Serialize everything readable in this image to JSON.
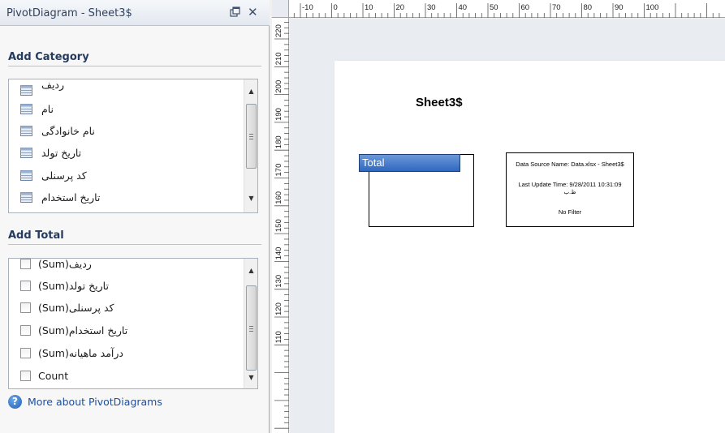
{
  "pane": {
    "title": "PivotDiagram - Sheet3$",
    "add_category": {
      "header": "Add Category",
      "items": [
        {
          "label": "ردیف",
          "icon": "category-table-icon"
        },
        {
          "label": "نام",
          "icon": "category-table-icon"
        },
        {
          "label": "نام خانوادگی",
          "icon": "category-table-icon"
        },
        {
          "label": "تاریخ تولد",
          "icon": "category-table-icon"
        },
        {
          "label": "کد پرسنلی",
          "icon": "category-table-icon"
        },
        {
          "label": "تاریخ استخدام",
          "icon": "category-table-icon"
        }
      ]
    },
    "add_total": {
      "header": "Add Total",
      "items": [
        {
          "label": "ردیف(Sum)",
          "checked": false
        },
        {
          "label": "تاریخ تولد(Sum)",
          "checked": false
        },
        {
          "label": "کد پرسنلی(Sum)",
          "checked": false
        },
        {
          "label": "تاریخ استخدام(Sum)",
          "checked": false
        },
        {
          "label": "درآمد ماهیانه(Sum)",
          "checked": false
        },
        {
          "label": "Count",
          "checked": false
        }
      ]
    },
    "help_link": "More about PivotDiagrams"
  },
  "rulers": {
    "horizontal_labels": [
      "-10",
      "0",
      "10",
      "20",
      "30",
      "40",
      "50",
      "60",
      "70",
      "80",
      "90",
      "100"
    ],
    "vertical_labels": [
      "220",
      "210",
      "200",
      "190",
      "180",
      "170",
      "160",
      "150",
      "140",
      "130",
      "120",
      "110"
    ]
  },
  "diagram": {
    "sheet_title": "Sheet3$",
    "total_label": "Total",
    "info": {
      "source": "Data Source Name: Data.xlsx - Sheet3$",
      "update": "Last Update Time: 9/28/2011 10:31:09",
      "update_suffix": "ظ.ب",
      "filter": "No Filter"
    }
  },
  "colors": {
    "accent": "#2f68c0",
    "link": "#1c4fa0"
  }
}
